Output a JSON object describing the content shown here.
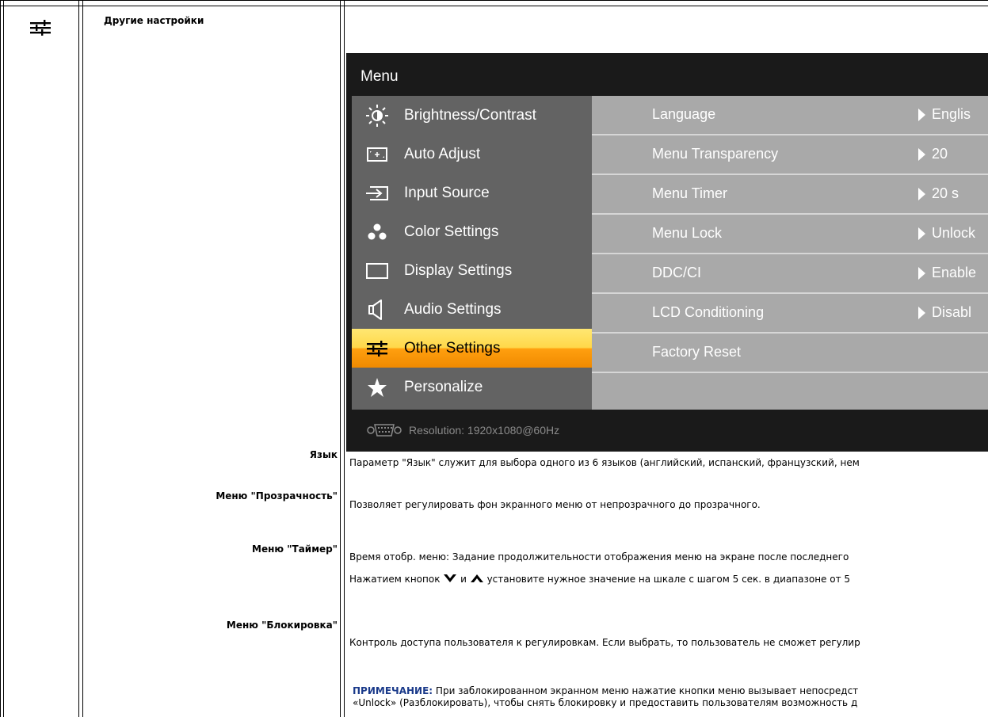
{
  "section": {
    "title": "Другие настройки",
    "icon": "other-settings-icon"
  },
  "osd": {
    "title": "Menu",
    "menu_items": [
      {
        "label": "Brightness/Contrast",
        "icon": "brightness-icon"
      },
      {
        "label": "Auto Adjust",
        "icon": "auto-adjust-icon"
      },
      {
        "label": "Input Source",
        "icon": "input-source-icon"
      },
      {
        "label": "Color Settings",
        "icon": "color-settings-icon"
      },
      {
        "label": "Display Settings",
        "icon": "display-settings-icon"
      },
      {
        "label": "Audio Settings",
        "icon": "speaker-icon"
      },
      {
        "label": "Other Settings",
        "icon": "other-settings-icon",
        "active": true
      },
      {
        "label": "Personalize",
        "icon": "star-icon"
      }
    ],
    "sub_items": [
      {
        "label": "Language",
        "value": "Englis"
      },
      {
        "label": "Menu Transparency",
        "value": "20"
      },
      {
        "label": "Menu Timer",
        "value": "20 s"
      },
      {
        "label": "Menu Lock",
        "value": "Unlock"
      },
      {
        "label": "DDC/CI",
        "value": "Enable"
      },
      {
        "label": "LCD Conditioning",
        "value": "Disabl"
      },
      {
        "label": "Factory Reset",
        "value": ""
      }
    ],
    "resolution": "Resolution:  1920x1080@60Hz",
    "colors": {
      "active_top": "#ffe772",
      "active_bottom": "#f08a00",
      "left_panel": "#636363",
      "right_panel": "#a9a9a9"
    }
  },
  "rows": {
    "language": {
      "label": "Язык",
      "desc": "Параметр \"Язык\" служит для выбора одного из 6 языков (английский, испанский, французский, нем"
    },
    "transparency": {
      "label": "Меню \"Прозрачность\"",
      "desc": "Позволяет регулировать фон экранного меню от непрозрачного до прозрачного."
    },
    "timer": {
      "label": "Меню \"Таймер\"",
      "desc1": "Время отобр. меню: Задание продолжительности отображения меню на экране после последнего",
      "desc2_a": "Нажатием кнопок",
      "desc2_b": "и",
      "desc2_c": "установите нужное значение на шкале с шагом 5 сек. в диапазоне от 5"
    },
    "lock": {
      "label": "Меню \"Блокировка\"",
      "desc": "Контроль доступа пользователя к регулировкам. Если выбрать, то пользователь не сможет регулир",
      "note_label": "ПРИМЕЧАНИЕ:",
      "note1": "При заблокированном экранном меню нажатие кнопки меню вызывает непосредст",
      "note2": "«Unlock» (Разблокировать), чтобы снять блокировку и предоставить пользователям возможность д"
    }
  }
}
